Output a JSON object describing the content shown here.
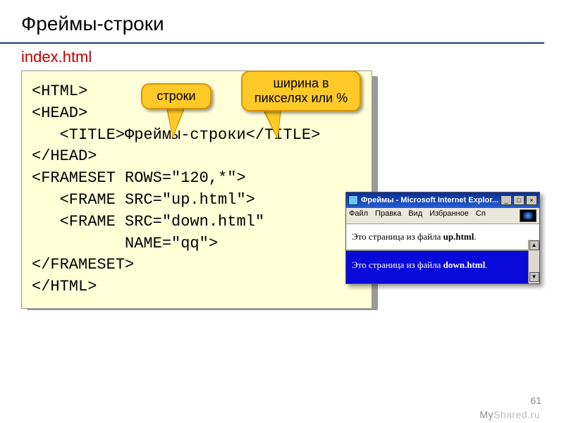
{
  "slide": {
    "title": "Фреймы-строки",
    "filename": "index.html",
    "page_number": "61",
    "watermark_left": "My",
    "watermark_right": "Shared.ru"
  },
  "callouts": {
    "rows": "строки",
    "width": "ширина в пикселях или %"
  },
  "code": {
    "l1": "<HTML>",
    "l2": "<HEAD>",
    "l3": "   <TITLE>Фреймы-строки</TITLE>",
    "l4": "</HEAD>",
    "l5": "<FRAMESET ROWS=\"120,*\">",
    "l6": "   <FRAME SRC=\"up.html\">",
    "l7": "   <FRAME SRC=\"down.html\"",
    "l8": "          NAME=\"qq\">",
    "l9": "</FRAMESET>",
    "l10": "</HTML>"
  },
  "browser": {
    "title": "Фреймы - Microsoft Internet Explor...",
    "menu": {
      "file": "Файл",
      "edit": "Правка",
      "view": "Вид",
      "fav": "Избранное",
      "more": "Сп"
    },
    "frame_top_a": "Это страница из файла ",
    "frame_top_b": "up.html",
    "frame_top_c": ".",
    "frame_bottom_a": "Это страница из файла ",
    "frame_bottom_b": "down.html",
    "frame_bottom_c": "."
  },
  "winbtn": {
    "min": "_",
    "max": "□",
    "close": "×",
    "up": "▲",
    "down": "▼"
  }
}
